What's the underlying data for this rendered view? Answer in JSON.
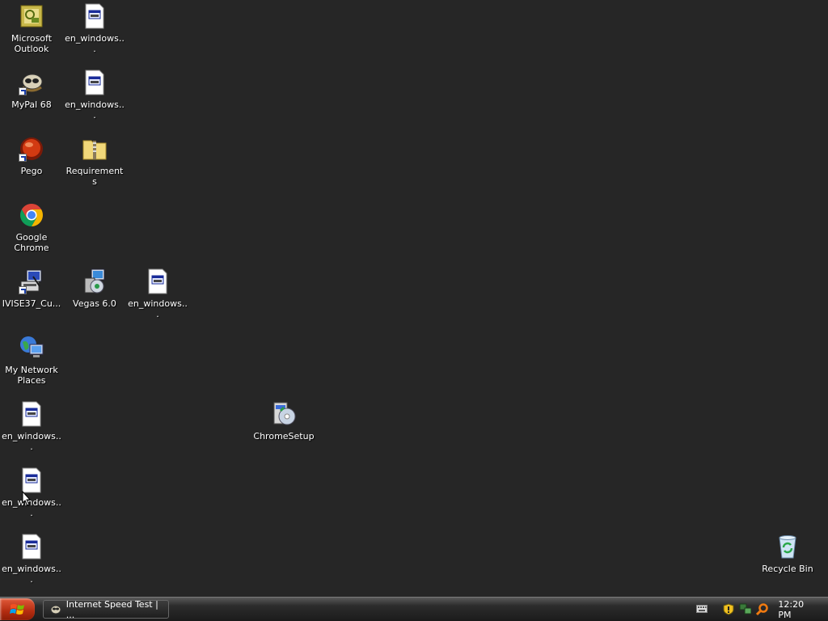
{
  "desktop": {
    "icons": [
      {
        "name": "icon-microsoft-outlook",
        "label": "Microsoft Outlook"
      },
      {
        "name": "icon-en-windows-1",
        "label": "en_windows..."
      },
      {
        "name": "icon-mypal-68",
        "label": "MyPal 68"
      },
      {
        "name": "icon-en-windows-2",
        "label": "en_windows..."
      },
      {
        "name": "icon-pego",
        "label": "Pego"
      },
      {
        "name": "icon-requirements",
        "label": "Requirements"
      },
      {
        "name": "icon-google-chrome",
        "label": "Google Chrome"
      },
      {
        "name": "icon-ivise37",
        "label": "IVISE37_Cu..."
      },
      {
        "name": "icon-vegas-6",
        "label": "Vegas 6.0"
      },
      {
        "name": "icon-en-windows-3",
        "label": "en_windows..."
      },
      {
        "name": "icon-my-network-places",
        "label": "My Network Places"
      },
      {
        "name": "icon-en-windows-4",
        "label": "en_windows..."
      },
      {
        "name": "icon-chromesetup",
        "label": "ChromeSetup"
      },
      {
        "name": "icon-en-windows-5",
        "label": "en_windows..."
      },
      {
        "name": "icon-en-windows-6",
        "label": "en_windows..."
      },
      {
        "name": "icon-recycle-bin",
        "label": "Recycle Bin"
      }
    ]
  },
  "taskbar": {
    "start_icon": "windows-logo-icon",
    "task_button": {
      "label": "Internet Speed Test | ...",
      "icon": "mypal-icon"
    },
    "tray_icons": [
      "keyboard-icon",
      "security-shield-icon",
      "network-icon",
      "search-icon"
    ],
    "clock": "12:20 PM"
  },
  "colors": {
    "desktop_background": "#262626",
    "start_button": "#b32c10"
  }
}
